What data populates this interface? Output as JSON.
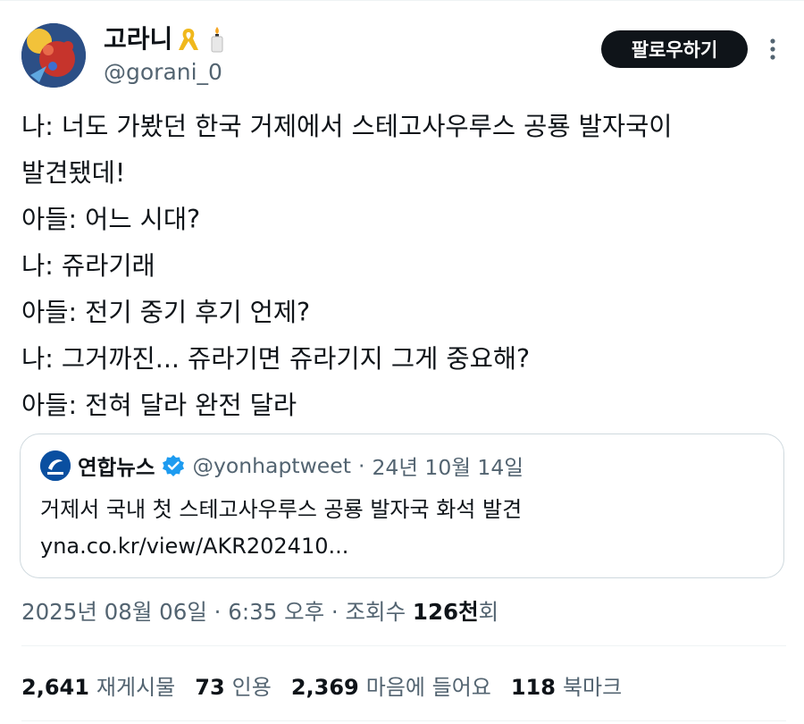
{
  "author": {
    "display_name": "고라니",
    "handle": "@gorani_0",
    "badge_icons": [
      "yellow-ribbon-icon",
      "candle-icon"
    ]
  },
  "follow_button_label": "팔로우하기",
  "tweet_lines": [
    "나: 너도 가봤던 한국 거제에서 스테고사우루스 공룡 발자국이",
    "발견됐데!",
    "아들: 어느 시대?",
    "나: 쥬라기래",
    "아들: 전기 중기 후기 언제?",
    "나: 그거까진... 쥬라기면 쥬라기지 그게 중요해?",
    "아들: 전혀 달라 완전 달라"
  ],
  "quote": {
    "name": "연합뉴스",
    "handle": "@yonhaptweet",
    "separator": "·",
    "date": "24년 10월 14일",
    "text": "거제서 국내 첫 스테고사우루스 공룡 발자국 화석 발견yna.co.kr/view/AKR202410..."
  },
  "meta": {
    "datetime": "2025년 08월 06일 · 6:35 오후 · 조회수 ",
    "views_bold": "126천",
    "views_suffix": "회"
  },
  "stats": [
    {
      "value": "2,641",
      "label": "재게시물"
    },
    {
      "value": "73",
      "label": "인용"
    },
    {
      "value": "2,369",
      "label": "마음에 들어요"
    },
    {
      "value": "118",
      "label": "북마크"
    }
  ],
  "colors": {
    "text": "#0f1419",
    "secondary": "#536471",
    "border": "#cfd9de",
    "verified": "#1d9bf0"
  }
}
